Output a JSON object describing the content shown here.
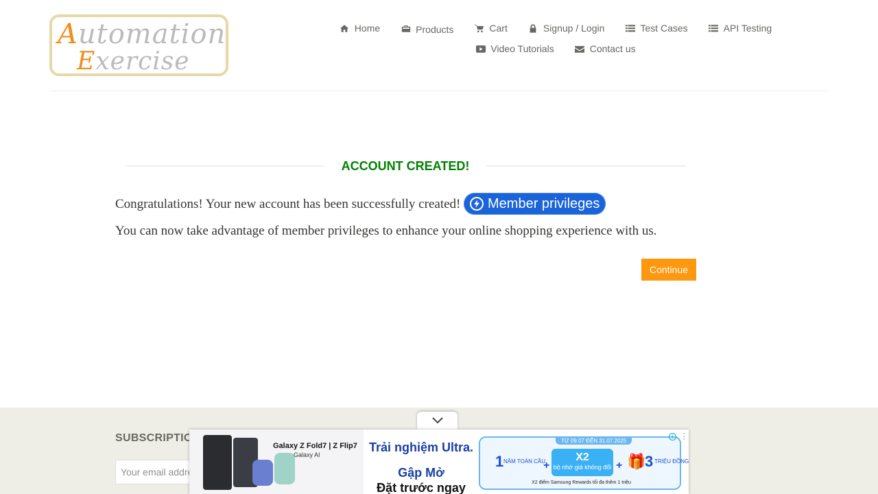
{
  "logo": {
    "line1_cap": "A",
    "line1_rest": "utomation",
    "line2_cap": "E",
    "line2_rest": "xercise"
  },
  "nav": {
    "row1": [
      {
        "label": "Home",
        "icon": "home-icon"
      },
      {
        "label": "Products",
        "icon": "briefcase-icon"
      },
      {
        "label": "Cart",
        "icon": "cart-icon"
      },
      {
        "label": "Signup / Login",
        "icon": "lock-icon"
      },
      {
        "label": "Test Cases",
        "icon": "list-icon"
      },
      {
        "label": "API Testing",
        "icon": "list-icon"
      }
    ],
    "row2": [
      {
        "label": "Video Tutorials",
        "icon": "youtube-play-icon"
      },
      {
        "label": "Contact us",
        "icon": "envelope-icon"
      }
    ]
  },
  "main": {
    "title": "ACCOUNT CREATED!",
    "message1": "Congratulations! Your new account has been successfully created!",
    "member_button": "Member privileges",
    "message2": "You can now take advantage of member privileges to enhance your online shopping experience with us.",
    "continue_label": "Continue"
  },
  "footer": {
    "subscription_title": "SUBSCRIPTION",
    "email_placeholder": "Your email address"
  },
  "ad": {
    "product": "Galaxy Z Fold7 | Z Flip7",
    "ai": "Galaxy AI",
    "headline1": "Trải nghiệm Ultra.",
    "headline2": "Gập Mở",
    "headline3": "Đặt trước ngay",
    "date_range": "TỪ 09.07 ĐẾN 31.07.2025",
    "offer1_big": "1",
    "offer1_small": "NĂM TOÀN CẦU",
    "offer2_big": "X2",
    "offer2_small": "bộ nhớ giá không đổi",
    "offer3_big": "3",
    "offer3_small": "TRIỆU ĐỒNG",
    "rewards": "X2 điểm Samsung Rewards tối đa thêm 1 triệu"
  },
  "colors": {
    "accent": "#fe980f",
    "success": "#008000",
    "member_blue": "#1a63d8",
    "footer_bg": "#eeeee6"
  }
}
